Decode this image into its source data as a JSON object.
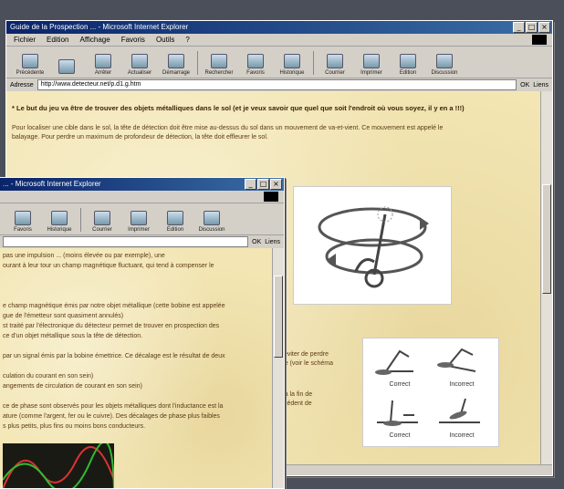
{
  "back_window": {
    "title": "Guide de la Prospection ... - Microsoft Internet Explorer",
    "menu": [
      "Fichier",
      "Edition",
      "Affichage",
      "Favoris",
      "Outils",
      "?"
    ],
    "toolbar": [
      "Précédente",
      "",
      "Arrêter",
      "Actualiser",
      "Démarrage",
      "Rechercher",
      "Favoris",
      "Historique",
      "Courrier",
      "Imprimer",
      "Edition",
      "Discussion"
    ],
    "address_label": "Adresse",
    "address_value": "http://www.detecteur.net/p.d1.g.htm",
    "go_label": "OK",
    "links_label": "Liens",
    "heading": "* Le but du jeu va être de trouver des objets métalliques dans le sol (et je veux savoir que quel que soit l'endroit où vous soyez, il y en a !!!)",
    "para1": "Pour localiser une cible dans le sol, la tête de détection doit être mise au-dessus du sol dans un mouvement de va-et-vient. Ce mouvement est appelé le",
    "para1b": "balayage. Pour perdre un maximum de profondeur de détection, la tête doit effleurer le sol.",
    "right_text_1": "pour éviter de perdre",
    "right_text_2": "layage (voir le schéma",
    "right_text_3": "ction à la fin de",
    "right_text_4": "e précédent de",
    "sweep_labels": [
      "Correct",
      "Incorrect",
      "Correct",
      "Incorrect"
    ]
  },
  "front_window": {
    "title": "... - Microsoft Internet Explorer",
    "toolbar": [
      "Favoris",
      "Historique",
      "Courrier",
      "Imprimer",
      "Edition",
      "Discussion"
    ],
    "go_label": "OK",
    "links_label": "Liens",
    "lines": [
      "pas une impulsion ... (moins élevée ou par exemple), une",
      "ourant à leur tour un champ magnétique fluctuant, qui tend à compenser le",
      "",
      "",
      "",
      "e champ magnétique émis par notre objet métallique (cette bobine est appelée",
      "gue de l'émetteur sont quasiment annulés)",
      "st traité par l'électronique du détecteur permet de trouver en prospection des",
      "ce d'un objet métallique sous la tête de détection.",
      "",
      "par un signal émis par la bobine émettrice. Ce décalage est le résultat de deux",
      "",
      "culation du courant en son sein)",
      "angements de circulation de courant en son sein)",
      "",
      "ce de phase sont observés pour les objets métalliques dont l'inductance est la",
      "ature (comme l'argent, fer ou le cuivre). Des décalages de phase plus faibles",
      "s plus petits, plus fins ou moins bons conducteurs."
    ]
  },
  "colors": {
    "titlebar_start": "#0a246a",
    "titlebar_end": "#3a6ea5",
    "page_background": "#f3e6b4",
    "page_text": "#5a3a18",
    "chrome": "#d4d0c8"
  }
}
